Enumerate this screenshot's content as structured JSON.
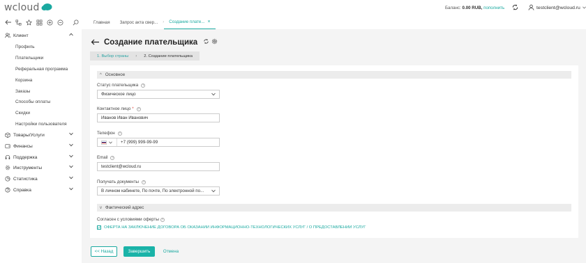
{
  "app": {
    "logo_text": "wcloud",
    "brand_color": "#1aa9a0"
  },
  "header": {
    "balance_label": "Баланс:",
    "balance_value": "0.00 RUB,",
    "topup_label": "пополнить",
    "user_email": "testclient@wcloud.ru"
  },
  "tabs": [
    {
      "label": "Главная"
    },
    {
      "label": "Запрос акта свер..."
    },
    {
      "label": "Создание плате..."
    }
  ],
  "sidebar": {
    "client": {
      "label": "Клиент"
    },
    "client_sub": [
      "Профиль",
      "Плательщики",
      "Реферальная программа",
      "Корзина",
      "Заказы",
      "Способы оплаты",
      "Скидки",
      "Настройки пользователя"
    ],
    "groups": [
      "Товары/Услуги",
      "Финансы",
      "Поддержка",
      "Инструменты",
      "Статистика",
      "Справка"
    ]
  },
  "page": {
    "title": "Создание плательщика",
    "steps": [
      "1. Выбор страны",
      "2. Создание плательщика"
    ]
  },
  "form": {
    "section_main": "Основное",
    "status_label": "Статус плательщика",
    "status_value": "Физическое лицо",
    "contact_label": "Контактное лицо",
    "contact_required": "*",
    "contact_value": "Иванов Иван Иванович",
    "phone_label": "Телефон",
    "phone_value": "+7 (999) 999-99-99",
    "email_label": "Email",
    "email_value": "testclient@wcloud.ru",
    "docs_label": "Получать документы",
    "docs_value": "В личном кабинете,  По почте,  По электронной по...",
    "section_address": "Фактический адрес",
    "offer_label": "Согласен с условиями оферты",
    "offer_link": "ОФЕРТА НА ЗАКЛЮЧЕНИЕ ДОГОВОРА ОБ ОКАЗАНИИ ИНФОРМАЦИОННО-ТЕХНОЛОГИЧЕСКИХ УСЛУГ / О ПРЕДОСТАВЛЕНИИ УСЛУГ"
  },
  "buttons": {
    "back": "<< Назад",
    "finish": "Завершить",
    "cancel": "Отмена"
  }
}
